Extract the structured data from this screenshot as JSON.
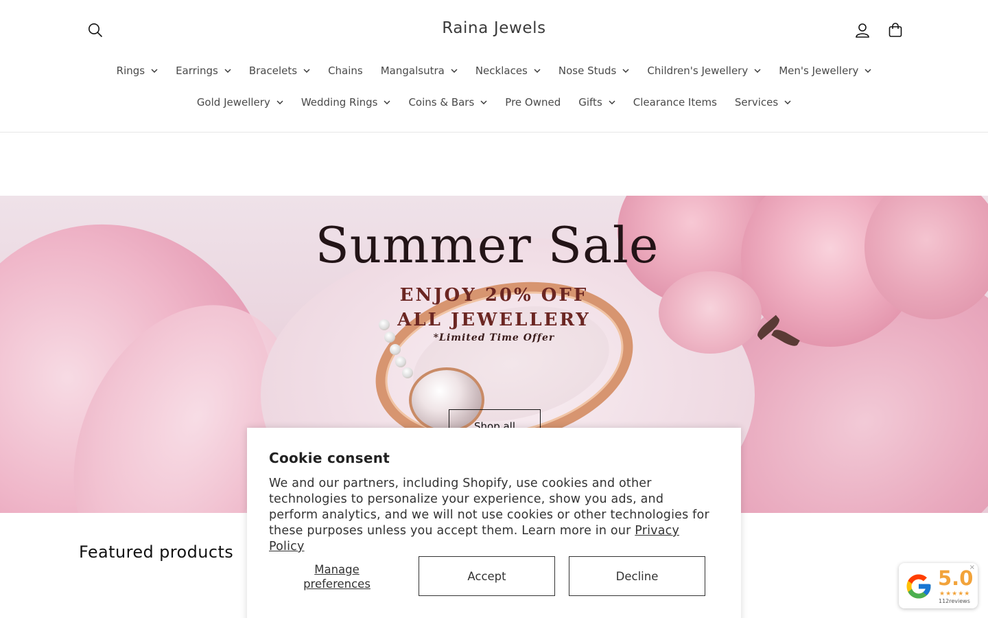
{
  "header": {
    "brand": "Raina Jewels",
    "icons": {
      "search": "search-icon",
      "account": "user-icon",
      "cart": "cart-icon"
    }
  },
  "nav": {
    "row1": [
      {
        "label": "Rings",
        "dropdown": true
      },
      {
        "label": "Earrings",
        "dropdown": true
      },
      {
        "label": "Bracelets",
        "dropdown": true
      },
      {
        "label": "Chains",
        "dropdown": false
      },
      {
        "label": "Mangalsutra",
        "dropdown": true
      },
      {
        "label": "Necklaces",
        "dropdown": true
      },
      {
        "label": "Nose Studs",
        "dropdown": true
      },
      {
        "label": "Children's Jewellery",
        "dropdown": true
      },
      {
        "label": "Men's Jewellery",
        "dropdown": true
      }
    ],
    "row2": [
      {
        "label": "Gold Jewellery",
        "dropdown": true
      },
      {
        "label": "Wedding Rings",
        "dropdown": true
      },
      {
        "label": "Coins & Bars",
        "dropdown": true
      },
      {
        "label": "Pre Owned",
        "dropdown": false
      },
      {
        "label": "Gifts",
        "dropdown": true
      },
      {
        "label": "Clearance Items",
        "dropdown": false
      },
      {
        "label": "Services",
        "dropdown": true
      }
    ]
  },
  "hero": {
    "title": "Summer Sale",
    "line1": "ENJOY 20% OFF",
    "line2": "ALL JEWELLERY",
    "note": "*Limited Time Offer",
    "button": "Shop all"
  },
  "featured": {
    "title": "Featured products"
  },
  "cookie": {
    "title": "Cookie consent",
    "text": "We and our partners, including Shopify, use cookies and other technologies to personalize your experience, show you ads, and perform analytics, and we will not use cookies or other technologies for these purposes unless you accept them. Learn more in our ",
    "link": "Privacy Policy",
    "manage": "Manage preferences",
    "accept": "Accept",
    "decline": "Decline"
  },
  "reviews_badge": {
    "rating": "5.0",
    "stars": "★★★★★",
    "count": "112reviews",
    "close": "×"
  },
  "colors": {
    "text": "#121212",
    "accent_star": "#f2a33a",
    "hero_bg": "#ead4de"
  }
}
